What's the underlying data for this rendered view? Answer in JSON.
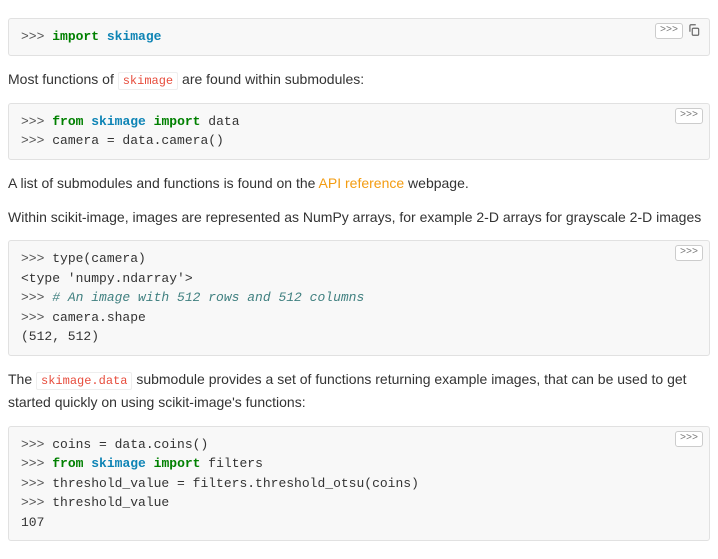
{
  "controls": {
    "toggle": ">>>"
  },
  "block1": {
    "l1_prompt": ">>> ",
    "l1_kw": "import",
    "l1_mod": "skimage"
  },
  "prose1_a": "Most functions of ",
  "prose1_code": "skimage",
  "prose1_b": " are found within submodules:",
  "block2": {
    "l1_prompt": ">>> ",
    "l1_kw1": "from",
    "l1_mod": "skimage",
    "l1_kw2": "import",
    "l1_name": " data",
    "l2_prompt": ">>> ",
    "l2_code": "camera = data.camera()"
  },
  "prose2_a": "A list of submodules and functions is found on the ",
  "prose2_link": "API reference",
  "prose2_b": " webpage.",
  "prose3": "Within scikit-image, images are represented as NumPy arrays, for example 2-D arrays for grayscale 2-D images",
  "block3": {
    "l1_prompt": ">>> ",
    "l1_code": "type(camera)",
    "l2_out": "<type 'numpy.ndarray'>",
    "l3_prompt": ">>> ",
    "l3_comment": "# An image with 512 rows and 512 columns",
    "l4_prompt": ">>> ",
    "l4_code": "camera.shape",
    "l5_out": "(512, 512)"
  },
  "prose4_a": "The ",
  "prose4_code": "skimage.data",
  "prose4_b": " submodule provides a set of functions returning example images, that can be used to get started quickly on using scikit-image's functions:",
  "block4": {
    "l1_prompt": ">>> ",
    "l1_code": "coins = data.coins()",
    "l2_prompt": ">>> ",
    "l2_kw1": "from",
    "l2_mod": "skimage",
    "l2_kw2": "import",
    "l2_name": " filters",
    "l3_prompt": ">>> ",
    "l3_code": "threshold_value = filters.threshold_otsu(coins)",
    "l4_prompt": ">>> ",
    "l4_code": "threshold_value",
    "l5_out": "107"
  }
}
